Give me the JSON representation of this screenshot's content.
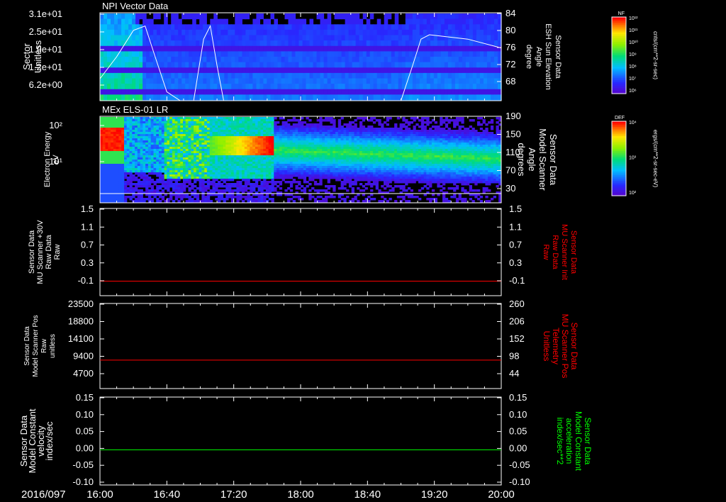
{
  "date_label": "2016/097",
  "time_ticks": [
    "16:00",
    "16:40",
    "17:20",
    "18:00",
    "18:40",
    "19:20",
    "20:00"
  ],
  "colors": {
    "background": "#000000",
    "axis": "#ffffff",
    "red_trace": "#ff0000",
    "green_trace": "#00ff00",
    "white_trace": "#ffffff"
  },
  "panels": [
    {
      "id": "npi",
      "title": "NPI Vector Data",
      "left_label": [
        "Sector",
        "Unitless"
      ],
      "left_ticks": [
        "3.1e+01",
        "2.5e+01",
        "1.9e+01",
        "1.2e+01",
        "6.2e+00"
      ],
      "right_ticks": [
        "84",
        "80",
        "76",
        "72",
        "68"
      ],
      "right_label": [
        "Sensor Data",
        "ESH Sun Elevation",
        "Angle",
        "degree"
      ],
      "colorbar": {
        "title": "NF",
        "units": "cnts/(cm**2-sr-sec)",
        "ticks": [
          "10¹²",
          "10¹¹",
          "10¹⁰",
          "10⁹",
          "10⁸",
          "10⁷",
          "10⁶"
        ]
      }
    },
    {
      "id": "els",
      "title": "MEx ELS-01 LR",
      "left_label": [
        "Electron Energy",
        "eV"
      ],
      "left_ticks": [
        "10²",
        "10¹"
      ],
      "right_ticks": [
        "190",
        "150",
        "110",
        "70",
        "30"
      ],
      "right_label": [
        "Sensor Data",
        "Model Scanner",
        "Angle",
        "degrees"
      ],
      "colorbar": {
        "title": "DEF",
        "units": "ergs/(cm**2-sr-sec-eV)",
        "ticks": [
          "10⁴",
          "10³",
          "10²"
        ]
      }
    },
    {
      "id": "mu30v",
      "left_label": [
        "Sensor Data",
        "MU Scanner +30V",
        "Raw Data",
        "Raw"
      ],
      "left_ticks": [
        "1.5",
        "1.1",
        "0.7",
        "0.3",
        "-0.1"
      ],
      "right_ticks": [
        "1.5",
        "1.1",
        "0.7",
        "0.3",
        "-0.1"
      ],
      "right_label": [
        "Sensor Data",
        "MU Scanner Init",
        "Raw Data",
        "Raw"
      ]
    },
    {
      "id": "scanpos",
      "left_label": [
        "Sensor Data",
        "Model Scanner Pos",
        "Raw",
        "unitless"
      ],
      "left_ticks": [
        "23500",
        "18800",
        "14100",
        "9400",
        "4700"
      ],
      "right_ticks": [
        "260",
        "206",
        "152",
        "98",
        "44"
      ],
      "right_label": [
        "Sensor Data",
        "MU Scanner Pos",
        "Telemetry",
        "Unitless"
      ]
    },
    {
      "id": "velocity",
      "left_label": [
        "Sensor Data",
        "Model Constant",
        "velocity",
        "index/sec"
      ],
      "left_ticks": [
        "0.15",
        "0.10",
        "0.05",
        "0.00",
        "-0.05",
        "-0.10"
      ],
      "right_ticks": [
        "0.15",
        "0.10",
        "0.05",
        "0.00",
        "-0.05",
        "-0.10"
      ],
      "right_label": [
        "Sensor Data",
        "Model Constant",
        "acceleration",
        "index/sec**2"
      ]
    }
  ],
  "chart_data": [
    {
      "type": "heatmap",
      "title": "NPI Vector Data",
      "xlabel": "",
      "ylabel": "Sector Unitless",
      "x_range": [
        "16:00",
        "20:00"
      ],
      "y_ticks": [
        31,
        25,
        19,
        12,
        6.2
      ],
      "overlay_series": {
        "name": "Sensor Data ESH Sun Elevation Angle",
        "units": "degree",
        "y2_range": [
          64,
          84
        ],
        "points": [
          [
            "16:00",
            69
          ],
          [
            "16:10",
            74
          ],
          [
            "16:20",
            80
          ],
          [
            "16:27",
            81
          ],
          [
            "16:33",
            74
          ],
          [
            "16:40",
            66
          ],
          [
            "16:48",
            64
          ],
          [
            "16:56",
            64
          ],
          [
            "17:02",
            78
          ],
          [
            "17:06",
            81
          ],
          [
            "17:10",
            72
          ],
          [
            "17:14",
            64
          ],
          [
            "17:40",
            64
          ],
          [
            "18:40",
            64
          ],
          [
            "19:00",
            64
          ],
          [
            "19:07",
            72
          ],
          [
            "19:12",
            78
          ],
          [
            "19:17",
            79
          ],
          [
            "19:40",
            78
          ],
          [
            "20:00",
            76
          ]
        ]
      }
    },
    {
      "type": "heatmap",
      "title": "MEx ELS-01 LR",
      "ylabel": "Electron Energy eV",
      "yscale": "log",
      "y_ticks": [
        "10²",
        "10¹"
      ],
      "x_range": [
        "16:00",
        "20:00"
      ],
      "overlay_series": {
        "name": "Sensor Data Model Scanner Angle",
        "units": "degrees",
        "y2_range": [
          10,
          190
        ],
        "points": [
          [
            "16:00",
            17
          ],
          [
            "20:00",
            17
          ]
        ]
      }
    },
    {
      "type": "line",
      "series": [
        {
          "name": "Sensor Data MU Scanner +30V Raw Data",
          "points": [
            [
              "16:00",
              0.0
            ],
            [
              "20:00",
              0.0
            ]
          ]
        }
      ],
      "ylim": [
        -0.3,
        1.5
      ],
      "y2lim": [
        -0.3,
        1.5
      ]
    },
    {
      "type": "line",
      "series": [
        {
          "name": "Sensor Data MU Scanner Pos Telemetry",
          "points": [
            [
              "16:00",
              87
            ],
            [
              "20:00",
              87
            ]
          ]
        }
      ],
      "ylim": [
        0,
        23500
      ],
      "y2lim": [
        0,
        260
      ]
    },
    {
      "type": "line",
      "series": [
        {
          "name": "Sensor Data Model Constant acceleration",
          "points": [
            [
              "16:00",
              0.0
            ],
            [
              "20:00",
              0.0
            ]
          ]
        }
      ],
      "ylim": [
        -0.1,
        0.15
      ],
      "y2lim": [
        -0.1,
        0.15
      ]
    }
  ]
}
